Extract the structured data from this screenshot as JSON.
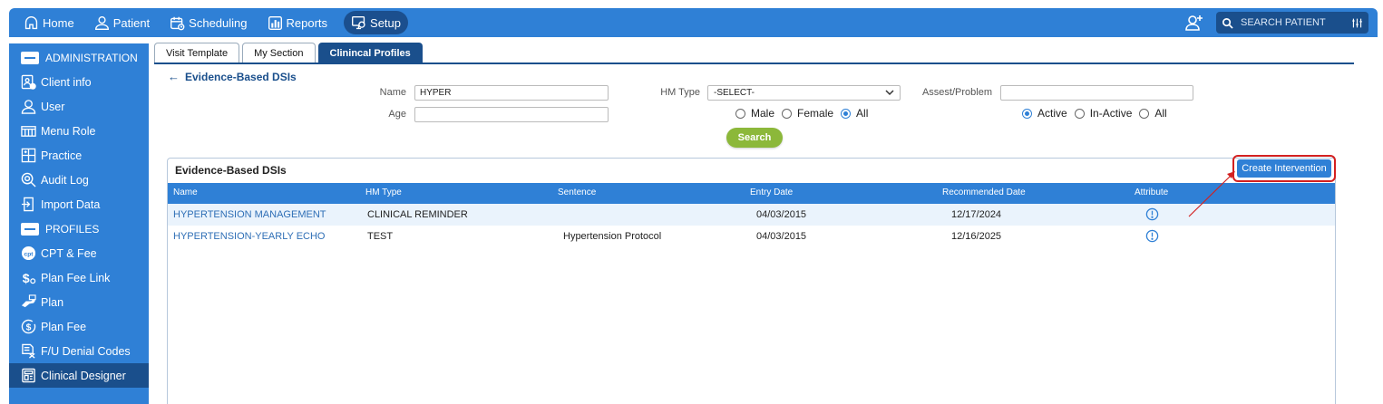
{
  "topnav": {
    "items": [
      {
        "label": "Home",
        "icon": "home-icon"
      },
      {
        "label": "Patient",
        "icon": "person-icon"
      },
      {
        "label": "Scheduling",
        "icon": "calendar-icon"
      },
      {
        "label": "Reports",
        "icon": "chart-icon"
      },
      {
        "label": "Setup",
        "icon": "monitor-gear-icon",
        "active": true
      }
    ],
    "search_placeholder": "SEARCH PATIENT"
  },
  "sidebar": {
    "sections": [
      {
        "title": "ADMINISTRATION",
        "items": [
          "Client info",
          "User",
          "Menu Role",
          "Practice",
          "Audit Log",
          "Import Data"
        ]
      },
      {
        "title": "PROFILES",
        "items": [
          "CPT & Fee",
          "Plan Fee Link",
          "Plan",
          "Plan Fee",
          "F/U Denial Codes",
          "Clinical Designer"
        ]
      }
    ],
    "active_item": "Clinical Designer"
  },
  "tabs": [
    "Visit Template",
    "My Section",
    "Clinincal Profiles"
  ],
  "active_tab": "Clinincal Profiles",
  "page": {
    "back_label": "Evidence-Based DSIs"
  },
  "filters": {
    "name_label": "Name",
    "name_value": "HYPER",
    "age_label": "Age",
    "age_value": "",
    "hm_type_label": "HM Type",
    "hm_type_value": "-SELECT-",
    "assess_label": "Assest/Problem",
    "assess_value": "",
    "gender_options": [
      "Male",
      "Female",
      "All"
    ],
    "gender_selected": "All",
    "status_options": [
      "Active",
      "In-Active",
      "All"
    ],
    "status_selected": "Active",
    "search_label": "Search"
  },
  "results": {
    "title": "Evidence-Based DSIs",
    "create_label": "Create Intervention",
    "columns": [
      "Name",
      "HM Type",
      "Sentence",
      "Entry Date",
      "Recommended Date",
      "Attribute"
    ],
    "rows": [
      {
        "name": "HYPERTENSION MANAGEMENT",
        "hm_type": "CLINICAL REMINDER",
        "sentence": "",
        "entry_date": "04/03/2015",
        "recommended_date": "12/17/2024"
      },
      {
        "name": "HYPERTENSION-YEARLY ECHO",
        "hm_type": "TEST",
        "sentence": "Hypertension Protocol",
        "entry_date": "04/03/2015",
        "recommended_date": "12/16/2025"
      }
    ]
  },
  "colors": {
    "primary": "#2f80d6",
    "dark": "#1a4f8c",
    "search_button": "#8cb83a",
    "highlight": "#d32020"
  }
}
